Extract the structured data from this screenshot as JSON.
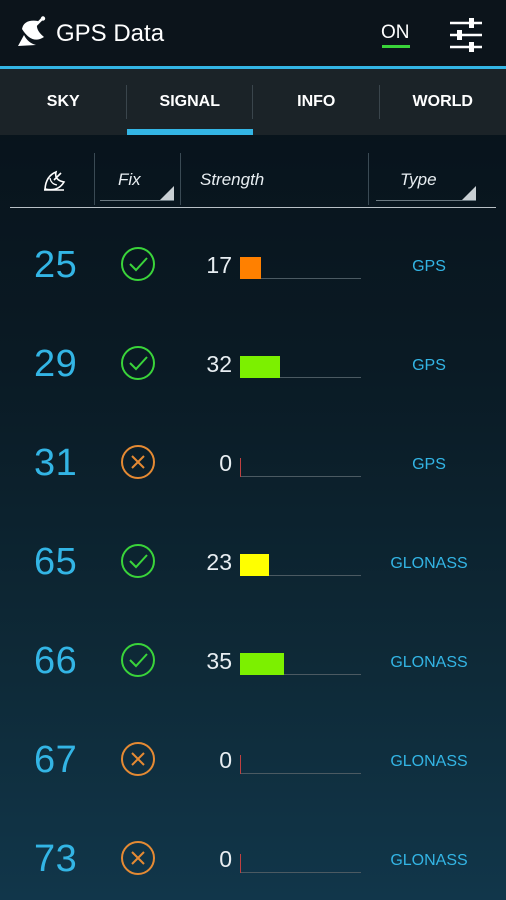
{
  "appbar": {
    "title": "GPS Data",
    "toggle_label": "ON",
    "toggle_color": "#3ad43a",
    "logo_icon": "satellite-dish-icon",
    "settings_icon": "sliders-icon"
  },
  "tabs": [
    {
      "label": "SKY",
      "active": false
    },
    {
      "label": "SIGNAL",
      "active": true
    },
    {
      "label": "INFO",
      "active": false
    },
    {
      "label": "WORLD",
      "active": false
    }
  ],
  "header": {
    "sat_icon": "satellite-dish-icon",
    "fix": "Fix",
    "strength": "Strength",
    "type": "Type"
  },
  "colors": {
    "accent": "#33b5e5",
    "fix_ok": "#3ad43a",
    "fix_no": "#e58a33"
  },
  "rows": [
    {
      "prn": "25",
      "fix": true,
      "strength": "17",
      "strength_value": 17,
      "bar_color": "#ff8000",
      "type": "GPS"
    },
    {
      "prn": "29",
      "fix": true,
      "strength": "32",
      "strength_value": 32,
      "bar_color": "#7cf000",
      "type": "GPS"
    },
    {
      "prn": "31",
      "fix": false,
      "strength": "0",
      "strength_value": 0,
      "bar_color": "#c04040",
      "type": "GPS"
    },
    {
      "prn": "65",
      "fix": true,
      "strength": "23",
      "strength_value": 23,
      "bar_color": "#ffff00",
      "type": "GLONASS"
    },
    {
      "prn": "66",
      "fix": true,
      "strength": "35",
      "strength_value": 35,
      "bar_color": "#7cf000",
      "type": "GLONASS"
    },
    {
      "prn": "67",
      "fix": false,
      "strength": "0",
      "strength_value": 0,
      "bar_color": "#c04040",
      "type": "GLONASS"
    },
    {
      "prn": "73",
      "fix": false,
      "strength": "0",
      "strength_value": 0,
      "bar_color": "#c04040",
      "type": "GLONASS"
    }
  ]
}
